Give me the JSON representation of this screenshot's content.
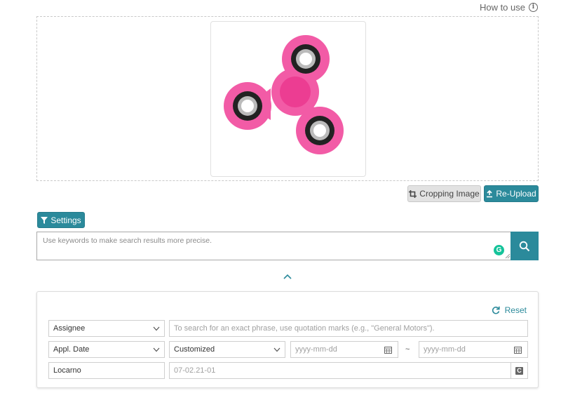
{
  "header": {
    "how_to_use": "How to use"
  },
  "upload": {
    "image_alt": "fidget spinner",
    "spinner_color": "#f25ba6",
    "crop_label": "Cropping Image",
    "reupload_label": "Re-Upload"
  },
  "settings_label": "Settings",
  "search": {
    "placeholder": "Use keywords to make search results more precise.",
    "accent": "#2b8a9b"
  },
  "filters": {
    "reset_label": "Reset",
    "rows": [
      {
        "field": "Assignee",
        "value_placeholder": "To search for an exact phrase, use quotation marks (e.g., \"General Motors\")."
      },
      {
        "field": "Appl. Date",
        "mode": "Customized",
        "from_placeholder": "yyyy-mm-dd",
        "separator": "~",
        "to_placeholder": "yyyy-mm-dd"
      },
      {
        "field": "Locarno",
        "value_placeholder": "07-02.21-01"
      }
    ]
  }
}
